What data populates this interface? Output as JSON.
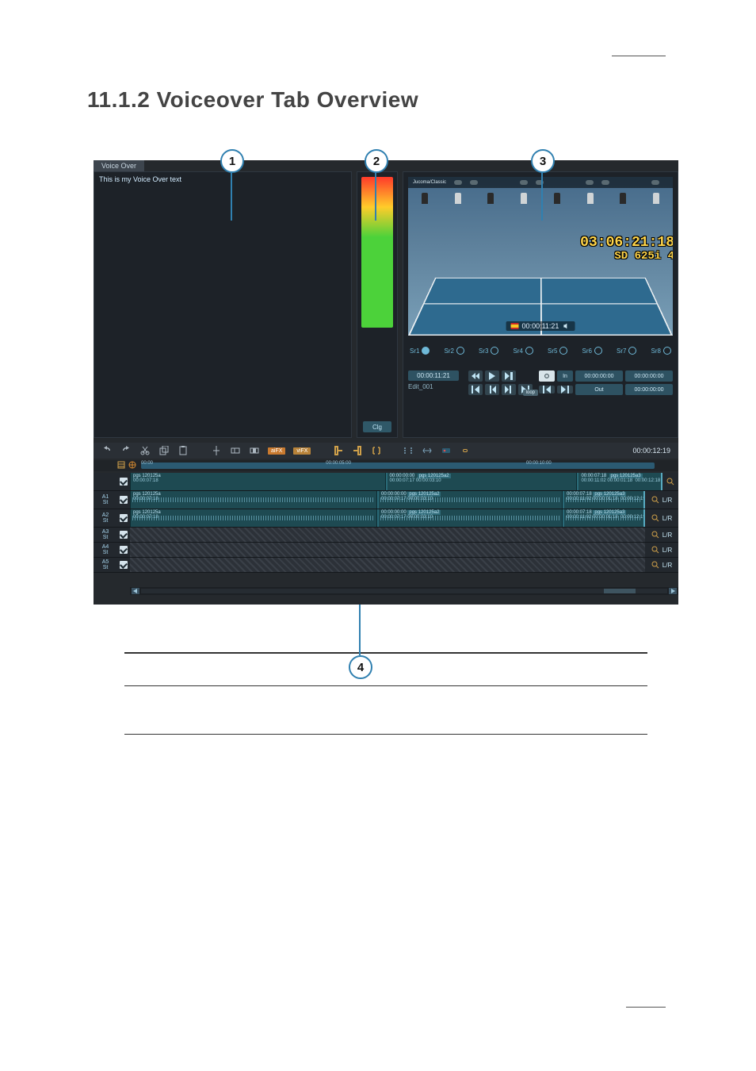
{
  "heading": "11.1.2 Voiceover Tab Overview",
  "callouts": {
    "c1": "1",
    "c2": "2",
    "c3": "3",
    "c4": "4"
  },
  "tab_label": "Voice Over",
  "vo_text": "This is my Voice Over text",
  "clg_label": "Clg",
  "monitor": {
    "scoreboard_label": "Jucoma/Classic",
    "tc_main": "03:06:21:18",
    "tc_sub": "SD 625i   4",
    "es_tc": "00:00:11:21",
    "sources": [
      "Sr1",
      "Sr2",
      "Sr3",
      "Sr4",
      "Sr5",
      "Sr6",
      "Sr7",
      "Sr8"
    ],
    "loop_tag": "loop",
    "pos_tc": "00:00:11:21",
    "edit_name": "Edit_001",
    "in_label": "In",
    "out_label": "Out",
    "in_tc": "00:00:00:00",
    "dur_tc": "00:00:00:00",
    "out_tc": "00:00:00:00"
  },
  "toolbar": {
    "chip1": "aiFX",
    "chip2": "viFX",
    "tc": "00:00:12:19"
  },
  "ruler": {
    "start": "00:00",
    "mid": "00:00:05:00",
    "end": "00:00:10:00"
  },
  "tracks": {
    "lr": "L/R",
    "video": {
      "clip1": {
        "name": "pgs 120125a",
        "tc": "00:00:07:18"
      },
      "clip2": {
        "in": "00:00:00:00",
        "name": "pgs 120125a2",
        "in2": "00:00:07:17",
        "tc2": "00:00:03:10"
      },
      "clip3": {
        "in": "00:00:07:18",
        "name": "pgs 120125a3",
        "in2": "00:00:11:02",
        "tc2": "00:00:01:18",
        "out": "00:00:12:18"
      }
    },
    "a1": {
      "label": "A1",
      "sub": "St",
      "clip1": {
        "name": "pgs 120125a",
        "tc": "00:00:07:18"
      },
      "clip2": {
        "in": "00:00:00:00",
        "name": "pgs 120125a2",
        "in2": "00:00:07:17",
        "tc2": "00:00:03:10"
      },
      "clip3": {
        "in": "00:00:07:18",
        "name": "pgs 120125a3",
        "in2": "00:00:11:02",
        "tc2": "00:00:01:18",
        "out": "00:00:12:19"
      }
    },
    "a2": {
      "label": "A2",
      "sub": "St",
      "clip1": {
        "name": "pgs 120125a",
        "tc": "00:00:07:18"
      },
      "clip2": {
        "in": "00:00:00:00",
        "name": "pgs 120125a2",
        "in2": "00:00:07:17",
        "tc2": "00:00:03:10"
      },
      "clip3": {
        "in": "00:00:07:18",
        "name": "pgs 120125a3",
        "in2": "00:00:11:02",
        "tc2": "00:00:01:18",
        "out": "00:00:12:19"
      }
    },
    "a3": {
      "label": "A3",
      "sub": "St"
    },
    "a4": {
      "label": "A4",
      "sub": "St"
    },
    "a5": {
      "label": "A5",
      "sub": "St"
    }
  }
}
